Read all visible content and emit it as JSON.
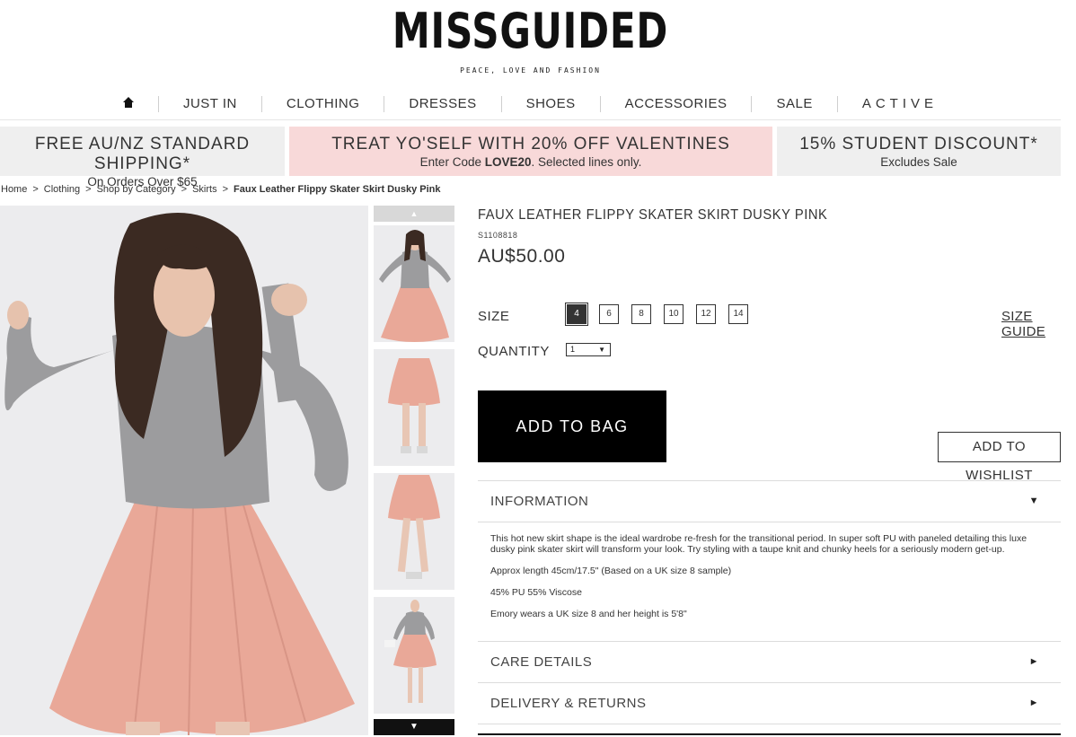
{
  "brand": {
    "logo": "MISSGUIDED",
    "tagline": "PEACE, LOVE AND FASHION"
  },
  "nav": {
    "home_icon": "home-icon",
    "items": [
      "JUST IN",
      "CLOTHING",
      "DRESSES",
      "SHOES",
      "ACCESSORIES",
      "SALE",
      "ACTIVE"
    ]
  },
  "promos": [
    {
      "headline": "FREE AU/NZ STANDARD SHIPPING*",
      "detail": "On Orders Over $65",
      "bg": "#efefef"
    },
    {
      "headline": "TREAT YO'SELF WITH 20% OFF VALENTINES",
      "detail_before": "Enter Code ",
      "code": "LOVE20",
      "detail_after": ". Selected lines only.",
      "bg": "#f8d9d9"
    },
    {
      "headline": "15% STUDENT DISCOUNT*",
      "detail": "Excludes Sale",
      "bg": "#efefef"
    }
  ],
  "breadcrumb": {
    "separator": ">",
    "items": [
      "Home",
      "Clothing",
      "Shop by Category",
      "Skirts"
    ],
    "current": "Faux Leather Flippy Skater Skirt Dusky Pink"
  },
  "gallery": {
    "up_icon": "▲",
    "down_icon": "▼",
    "thumbnail_count": 4
  },
  "product": {
    "title": "FAUX LEATHER FLIPPY SKATER SKIRT DUSKY PINK",
    "code": "S1108818",
    "price": "AU$50.00",
    "size_label": "SIZE",
    "sizes": [
      "4",
      "6",
      "8",
      "10",
      "12",
      "14"
    ],
    "selected_size": "4",
    "size_guide": "SIZE GUIDE",
    "quantity_label": "QUANTITY",
    "quantity_value": "1",
    "add_to_bag": "ADD TO BAG",
    "add_to_wishlist": "ADD TO WISHLIST"
  },
  "accordion": {
    "information": {
      "title": "INFORMATION",
      "icon": "▼",
      "paragraphs": [
        "This hot new skirt shape is the ideal wardrobe re-fresh for the transitional period. In super soft PU with paneled detailing this luxe dusky pink skater skirt will transform your look. Try styling with a taupe knit and chunky heels for a seriously modern get-up.",
        "Approx length 45cm/17.5\" (Based on a UK size 8 sample)",
        "45% PU 55% Viscose",
        "Emory wears a UK size 8 and her height is 5'8\""
      ]
    },
    "care": {
      "title": "CARE DETAILS",
      "icon": "►"
    },
    "delivery": {
      "title": "DELIVERY & RETURNS",
      "icon": "►"
    }
  },
  "colors": {
    "skirt_pink": "#e9a898",
    "top_grey": "#9c9c9e",
    "promo_pink": "#f8d9d9",
    "promo_grey": "#efefef",
    "button_black": "#000000"
  }
}
